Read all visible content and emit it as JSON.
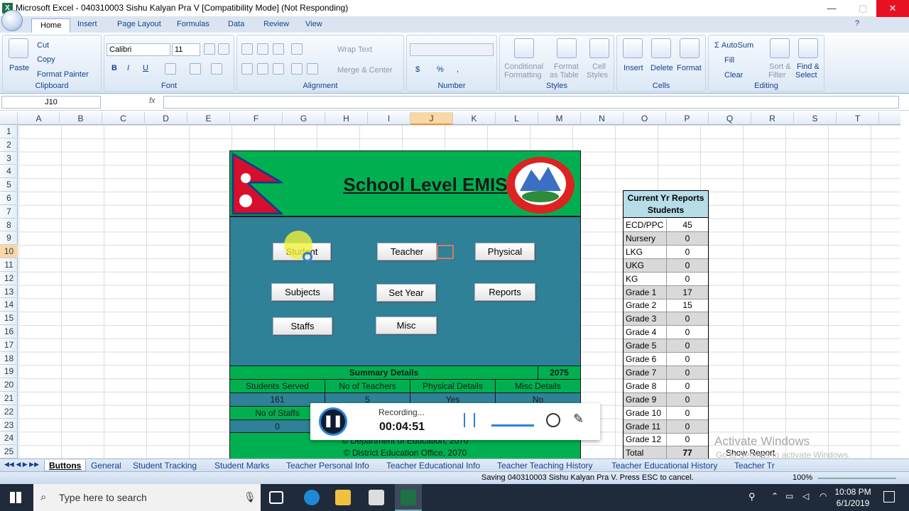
{
  "window": {
    "title": "Microsoft Excel - 040310003 Sishu Kalyan Pra V  [Compatibility Mode] (Not Responding)",
    "minimize": "—",
    "maximize": "▢",
    "close": "✕"
  },
  "ribbon_tabs": [
    "Home",
    "Insert",
    "Page Layout",
    "Formulas",
    "Data",
    "Review",
    "View"
  ],
  "clipboard": {
    "paste": "Paste",
    "cut": "Cut",
    "copy": "Copy",
    "format_painter": "Format Painter",
    "label": "Clipboard"
  },
  "font": {
    "family": "Calibri",
    "size": "11",
    "bold": "B",
    "italic": "I",
    "underline": "U",
    "label": "Font"
  },
  "alignment": {
    "wrap_text": "Wrap Text",
    "merge_center": "Merge & Center",
    "label": "Alignment"
  },
  "number": {
    "currency": "$",
    "percent": "%",
    "comma": ",",
    "label": "Number"
  },
  "styles": {
    "conditional": "Conditional",
    "formatting": "Formatting",
    "format_as": "Format",
    "as_table": "as Table",
    "cell": "Cell",
    "cell_styles": "Styles",
    "label": "Styles"
  },
  "cells": {
    "insert": "Insert",
    "delete": "Delete",
    "format": "Format",
    "label": "Cells"
  },
  "editing": {
    "autosum": "AutoSum",
    "fill": "Fill",
    "clear": "Clear",
    "sort": "Sort &",
    "filter": "Filter",
    "find": "Find &",
    "select": "Select",
    "label": "Editing"
  },
  "formula_bar": {
    "name_box": "J10",
    "fx": "fx"
  },
  "columns": [
    "A",
    "B",
    "C",
    "D",
    "E",
    "F",
    "G",
    "H",
    "I",
    "J",
    "K",
    "L",
    "M",
    "N",
    "O",
    "P",
    "Q",
    "R",
    "S",
    "T"
  ],
  "selected_column": "J",
  "rows": [
    "1",
    "2",
    "3",
    "4",
    "5",
    "6",
    "7",
    "8",
    "9",
    "10",
    "11",
    "12",
    "13",
    "14",
    "15",
    "16",
    "17",
    "18",
    "19",
    "20",
    "21",
    "22",
    "23",
    "24",
    "25"
  ],
  "selected_row": "10",
  "emis": {
    "title": "School Level EMIS",
    "buttons": {
      "student": "Student",
      "teacher": "Teacher",
      "physical": "Physical",
      "subjects": "Subjects",
      "set_year": "Set Year",
      "reports": "Reports",
      "staffs": "Staffs",
      "misc": "Misc"
    },
    "summary_title": "Summary Details",
    "year": "2075",
    "headers": [
      "Students Served",
      "No of Teachers",
      "Physical Details",
      "Misc Details"
    ],
    "values": [
      "161",
      "5",
      "Yes",
      "No"
    ],
    "staffs_label": "No of Staffs",
    "staffs_value": "0",
    "footer1": "© Department of Education, 2070",
    "footer2": "© District Education Office, 2070"
  },
  "report": {
    "head1": "Current Yr Reports",
    "head2": "Students",
    "rows": [
      {
        "k": "ECD/PPC",
        "v": "45"
      },
      {
        "k": "Nursery",
        "v": "0"
      },
      {
        "k": "LKG",
        "v": "0"
      },
      {
        "k": "UKG",
        "v": "0"
      },
      {
        "k": "KG",
        "v": "0"
      },
      {
        "k": "Grade 1",
        "v": "17"
      },
      {
        "k": "Grade 2",
        "v": "15"
      },
      {
        "k": "Grade 3",
        "v": "0"
      },
      {
        "k": "Grade 4",
        "v": "0"
      },
      {
        "k": "Grade 5",
        "v": "0"
      },
      {
        "k": "Grade 6",
        "v": "0"
      },
      {
        "k": "Grade 7",
        "v": "0"
      },
      {
        "k": "Grade 8",
        "v": "0"
      },
      {
        "k": "Grade 9",
        "v": "0"
      },
      {
        "k": "Grade 10",
        "v": "0"
      },
      {
        "k": "Grade 11",
        "v": "0"
      },
      {
        "k": "Grade 12",
        "v": "0"
      },
      {
        "k": "Total",
        "v": "77"
      }
    ]
  },
  "show_report": "Show Report",
  "watermark": {
    "line1": "Activate Windows",
    "line2": "Go to Settings to activate Windows."
  },
  "recording": {
    "label": "Recording...",
    "time": "00:04:51"
  },
  "sheet_tabs": [
    "Buttons",
    "General",
    "Student Tracking",
    "Student Marks",
    "Teacher Personal Info",
    "Teacher Educational Info",
    "Teacher Teaching History",
    "Teacher Educational History",
    "Teacher Tr"
  ],
  "status": {
    "message": "Saving 040310003 Sishu Kalyan Pra V. Press ESC to cancel.",
    "zoom": "100%"
  },
  "taskbar": {
    "search_placeholder": "Type here to search",
    "time": "10:08 PM",
    "date": "6/1/2019"
  },
  "colors": {
    "emis_green": "#00b050",
    "emis_teal": "#2e8196",
    "report_header": "#b7dde8"
  }
}
